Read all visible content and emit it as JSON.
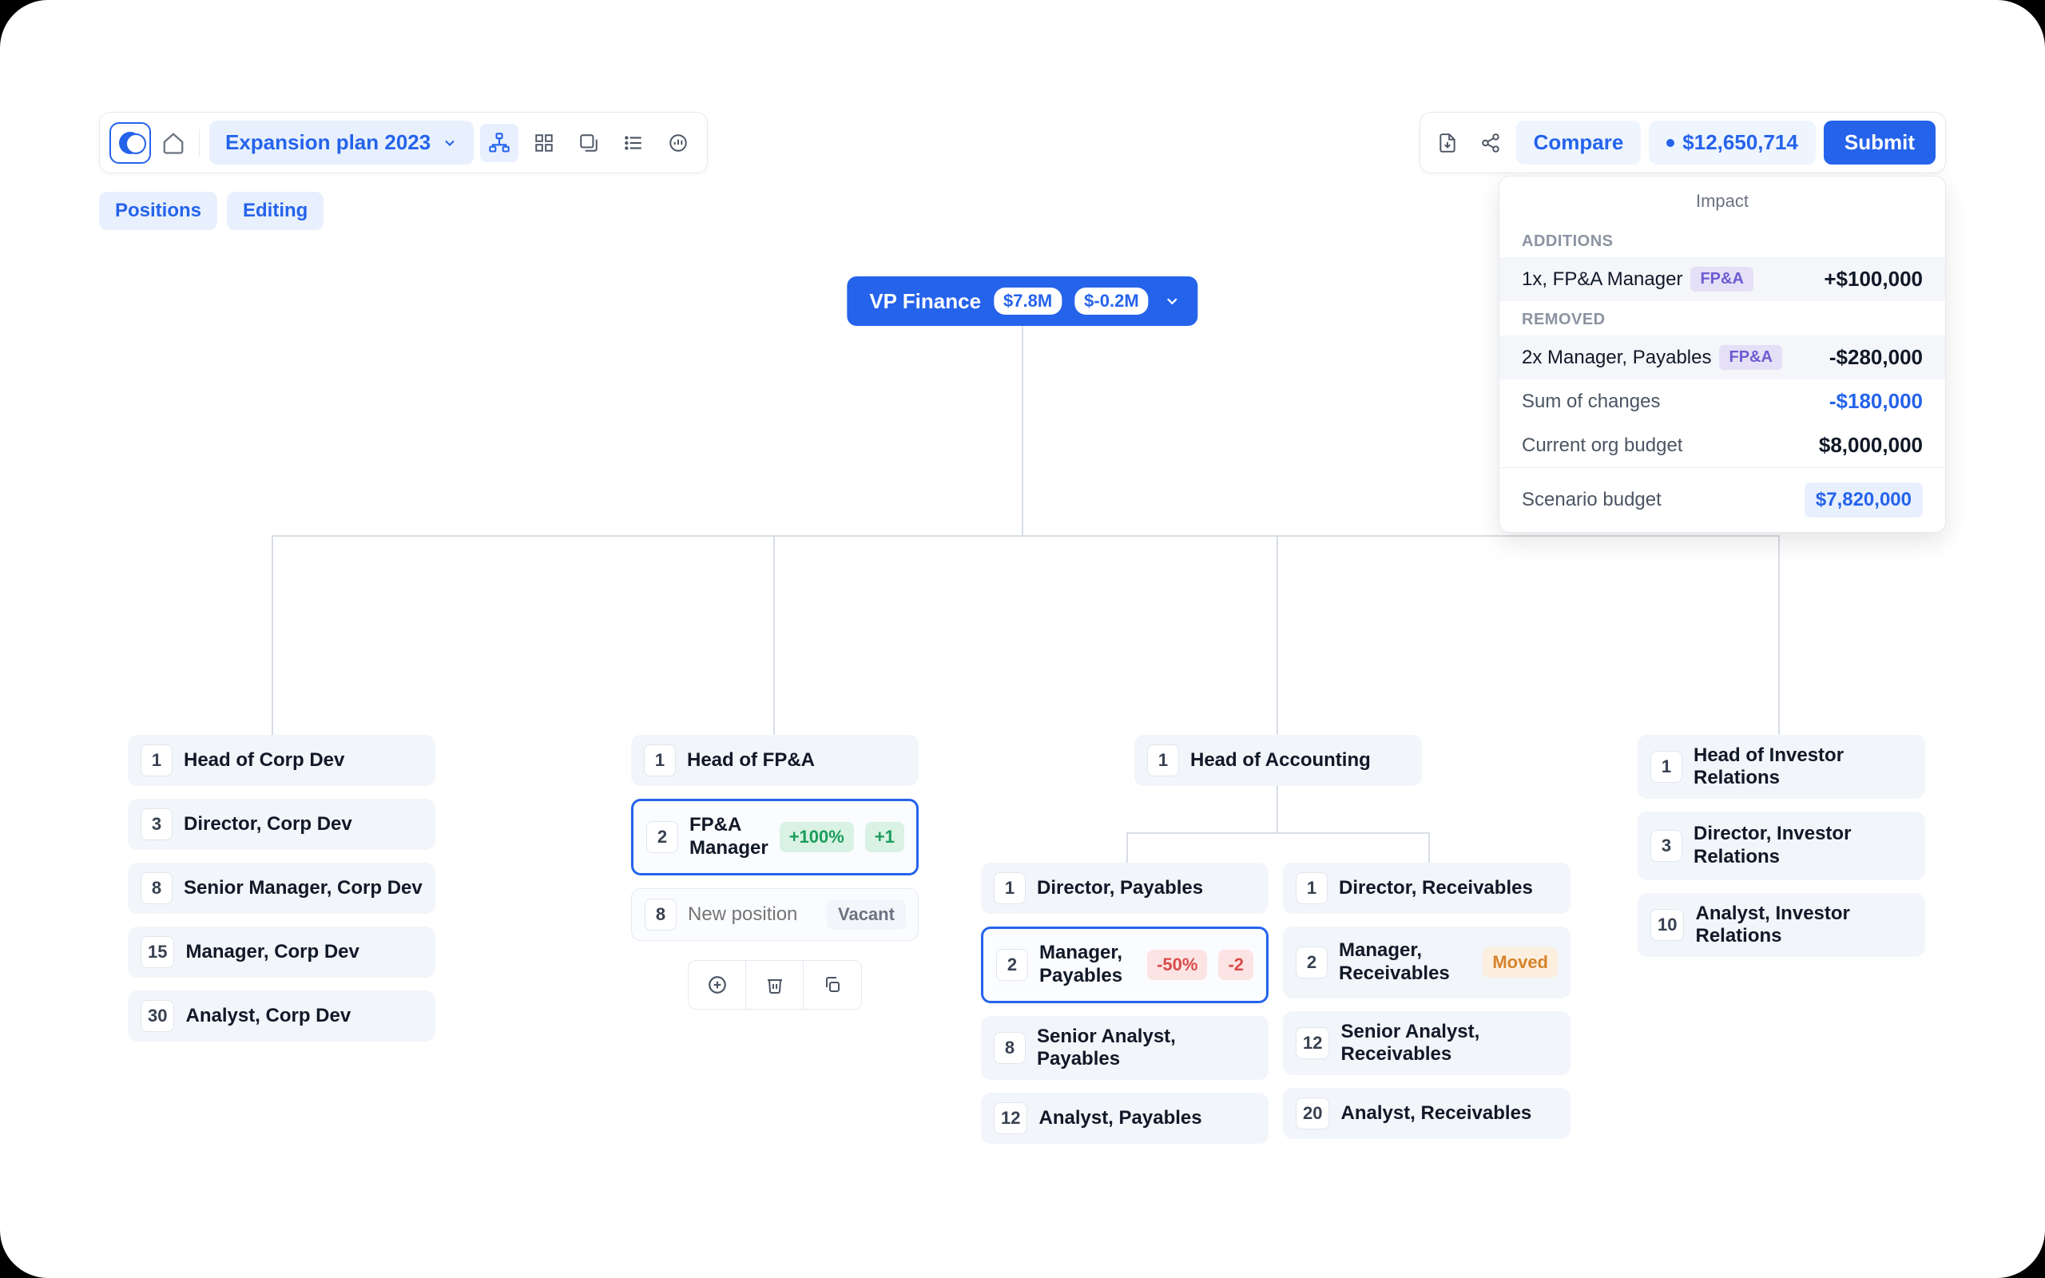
{
  "toolbar": {
    "scenario_name": "Expansion plan 2023",
    "compare_label": "Compare",
    "total": "$12,650,714",
    "submit_label": "Submit"
  },
  "chips": {
    "positions": "Positions",
    "editing": "Editing"
  },
  "root": {
    "title": "VP Finance",
    "budget": "$7.8M",
    "delta": "$-0.2M"
  },
  "impact": {
    "title": "Impact",
    "additions_label": "ADDITIONS",
    "addition": {
      "text": "1x, FP&A Manager",
      "tag": "FP&A",
      "amount": "+$100,000"
    },
    "removed_label": "REMOVED",
    "removed": {
      "text": "2x Manager, Payables",
      "tag": "FP&A",
      "amount": "-$280,000"
    },
    "sum_label": "Sum of changes",
    "sum_amount": "-$180,000",
    "current_label": "Current org budget",
    "current_amount": "$8,000,000",
    "scenario_label": "Scenario budget",
    "scenario_amount": "$7,820,000"
  },
  "corpdev": [
    {
      "n": "1",
      "t": "Head of Corp Dev"
    },
    {
      "n": "3",
      "t": "Director, Corp Dev"
    },
    {
      "n": "8",
      "t": "Senior Manager, Corp Dev"
    },
    {
      "n": "15",
      "t": "Manager, Corp Dev"
    },
    {
      "n": "30",
      "t": "Analyst, Corp Dev"
    }
  ],
  "fpa": {
    "head": {
      "n": "1",
      "t": "Head of FP&A"
    },
    "manager": {
      "n": "2",
      "t": "FP&A Manager",
      "pct": "+100%",
      "delta": "+1"
    },
    "newpos": {
      "n": "8",
      "placeholder": "New position",
      "vacant": "Vacant"
    }
  },
  "accounting": {
    "n": "1",
    "t": "Head of Accounting"
  },
  "payables": [
    {
      "n": "1",
      "t": "Director, Payables"
    },
    {
      "n": "2",
      "t": "Manager, Payables",
      "pct": "-50%",
      "delta": "-2",
      "sel": true
    },
    {
      "n": "8",
      "t": "Senior Analyst, Payables"
    },
    {
      "n": "12",
      "t": "Analyst, Payables"
    }
  ],
  "receivables": [
    {
      "n": "1",
      "t": "Director, Receivables"
    },
    {
      "n": "2",
      "t": "Manager, Receivables",
      "moved": "Moved"
    },
    {
      "n": "12",
      "t": "Senior Analyst, Receivables"
    },
    {
      "n": "20",
      "t": "Analyst, Receivables"
    }
  ],
  "ir": [
    {
      "n": "1",
      "t": "Head of Investor Relations"
    },
    {
      "n": "3",
      "t": "Director, Investor Relations"
    },
    {
      "n": "10",
      "t": "Analyst, Investor Relations"
    }
  ]
}
